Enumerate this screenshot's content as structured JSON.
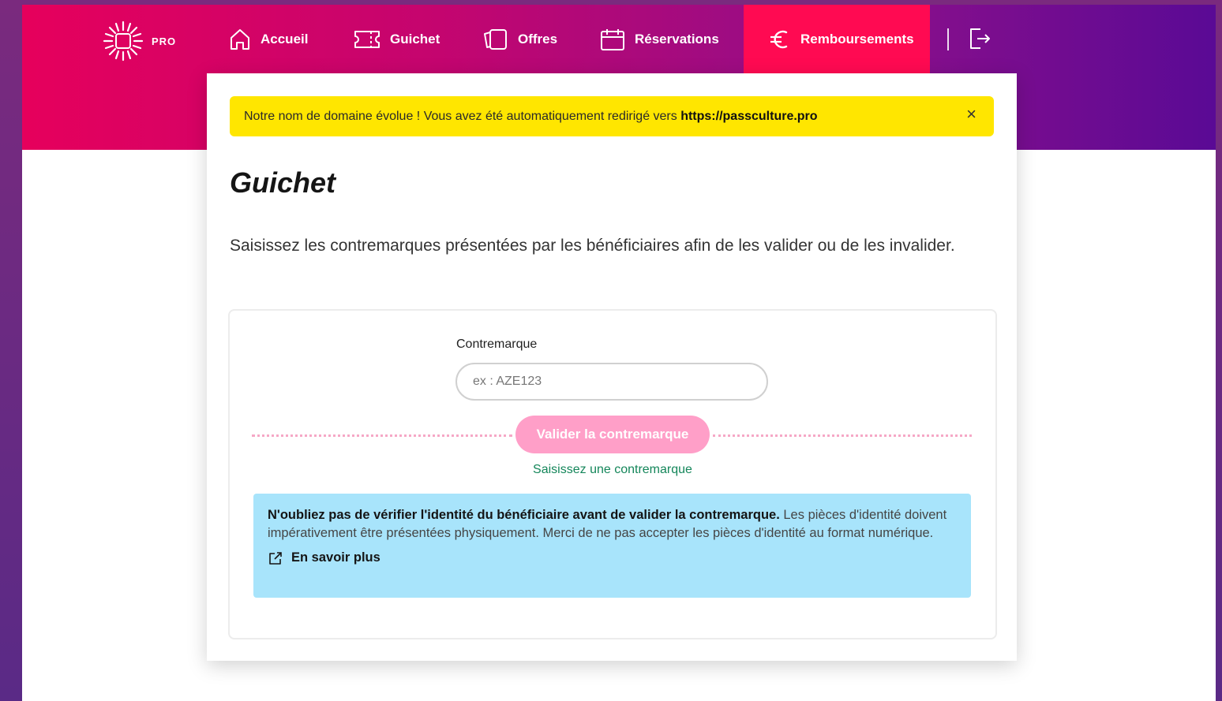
{
  "nav": {
    "logo_text": "PRO",
    "items": [
      {
        "label": "Accueil",
        "icon": "home-icon"
      },
      {
        "label": "Guichet",
        "icon": "ticket-icon"
      },
      {
        "label": "Offres",
        "icon": "offers-icon"
      },
      {
        "label": "Réservations",
        "icon": "calendar-icon"
      },
      {
        "label": "Remboursements",
        "icon": "euro-icon",
        "active": true
      }
    ],
    "logout_icon": "logout-icon"
  },
  "banner": {
    "text": "Notre nom de domaine évolue ! Vous avez été automatiquement redirigé vers ",
    "url": "https://passculture.pro",
    "close": "×"
  },
  "page": {
    "title": "Guichet",
    "description": "Saisissez les contremarques présentées par les bénéficiaires afin de les valider ou de les invalider."
  },
  "form": {
    "label": "Contremarque",
    "placeholder": "ex : AZE123",
    "value": "",
    "button_label": "Valider la contremarque",
    "helper_text": "Saisissez une contremarque"
  },
  "info": {
    "bold": "N'oubliez pas de vérifier l'identité du bénéficiaire avant de valider la contremarque.",
    "text": " Les pièces d'identité doivent impérativement être présentées physiquement. Merci de ne pas accepter les pièces d'identité au format numérique.",
    "link_label": "En savoir plus",
    "link_icon": "external-link-icon"
  },
  "colors": {
    "header_start": "#e6005c",
    "header_end": "#5a0a95",
    "active_tab": "#ff0a52",
    "banner": "#ffe600",
    "button": "#ff9fc8",
    "info_bg": "#a8e4fb",
    "helper": "#14865a"
  }
}
